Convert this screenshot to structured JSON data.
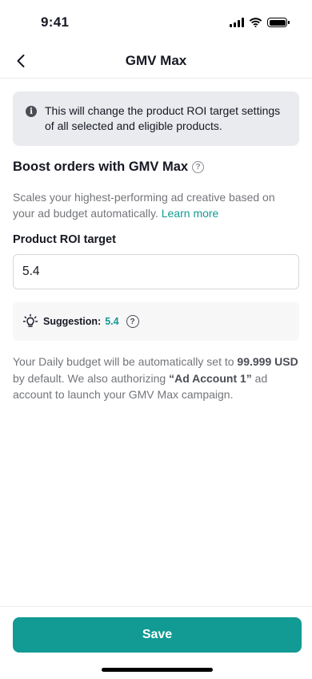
{
  "status_bar": {
    "time": "9:41"
  },
  "nav": {
    "title": "GMV Max"
  },
  "notice": {
    "text": "This will change the product ROI target settings of all selected and eligible products."
  },
  "section": {
    "title": "Boost orders with GMV Max",
    "description": "Scales your highest-performing ad creative based on your ad budget automatically.",
    "learn_more": "Learn more"
  },
  "roi": {
    "label": "Product ROI target",
    "value": "5.4"
  },
  "suggestion": {
    "label": "Suggestion:",
    "value": "5.4"
  },
  "info": {
    "part1": "Your Daily budget will be automatically set to ",
    "budget": "99.999 USD",
    "part2": " by default. We also authorizing ",
    "account": "“Ad Account 1”",
    "part3": " ad account to launch your GMV Max campaign."
  },
  "footer": {
    "save_label": "Save"
  },
  "colors": {
    "accent": "#129a94",
    "notice_bg": "#e9ebee",
    "text": "#161823",
    "muted": "#73757b"
  },
  "icons": {
    "back": "chevron-left-icon",
    "info": "info-icon",
    "help": "question-circle-icon",
    "bulb": "lightbulb-icon"
  }
}
